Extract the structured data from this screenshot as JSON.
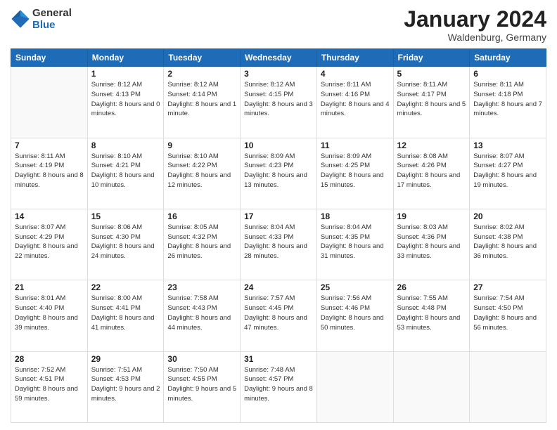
{
  "header": {
    "logo_line1": "General",
    "logo_line2": "Blue",
    "month_year": "January 2024",
    "location": "Waldenburg, Germany"
  },
  "weekdays": [
    "Sunday",
    "Monday",
    "Tuesday",
    "Wednesday",
    "Thursday",
    "Friday",
    "Saturday"
  ],
  "weeks": [
    [
      {
        "day": "",
        "sunrise": "",
        "sunset": "",
        "daylight": ""
      },
      {
        "day": "1",
        "sunrise": "Sunrise: 8:12 AM",
        "sunset": "Sunset: 4:13 PM",
        "daylight": "Daylight: 8 hours and 0 minutes."
      },
      {
        "day": "2",
        "sunrise": "Sunrise: 8:12 AM",
        "sunset": "Sunset: 4:14 PM",
        "daylight": "Daylight: 8 hours and 1 minute."
      },
      {
        "day": "3",
        "sunrise": "Sunrise: 8:12 AM",
        "sunset": "Sunset: 4:15 PM",
        "daylight": "Daylight: 8 hours and 3 minutes."
      },
      {
        "day": "4",
        "sunrise": "Sunrise: 8:11 AM",
        "sunset": "Sunset: 4:16 PM",
        "daylight": "Daylight: 8 hours and 4 minutes."
      },
      {
        "day": "5",
        "sunrise": "Sunrise: 8:11 AM",
        "sunset": "Sunset: 4:17 PM",
        "daylight": "Daylight: 8 hours and 5 minutes."
      },
      {
        "day": "6",
        "sunrise": "Sunrise: 8:11 AM",
        "sunset": "Sunset: 4:18 PM",
        "daylight": "Daylight: 8 hours and 7 minutes."
      }
    ],
    [
      {
        "day": "7",
        "sunrise": "Sunrise: 8:11 AM",
        "sunset": "Sunset: 4:19 PM",
        "daylight": "Daylight: 8 hours and 8 minutes."
      },
      {
        "day": "8",
        "sunrise": "Sunrise: 8:10 AM",
        "sunset": "Sunset: 4:21 PM",
        "daylight": "Daylight: 8 hours and 10 minutes."
      },
      {
        "day": "9",
        "sunrise": "Sunrise: 8:10 AM",
        "sunset": "Sunset: 4:22 PM",
        "daylight": "Daylight: 8 hours and 12 minutes."
      },
      {
        "day": "10",
        "sunrise": "Sunrise: 8:09 AM",
        "sunset": "Sunset: 4:23 PM",
        "daylight": "Daylight: 8 hours and 13 minutes."
      },
      {
        "day": "11",
        "sunrise": "Sunrise: 8:09 AM",
        "sunset": "Sunset: 4:25 PM",
        "daylight": "Daylight: 8 hours and 15 minutes."
      },
      {
        "day": "12",
        "sunrise": "Sunrise: 8:08 AM",
        "sunset": "Sunset: 4:26 PM",
        "daylight": "Daylight: 8 hours and 17 minutes."
      },
      {
        "day": "13",
        "sunrise": "Sunrise: 8:07 AM",
        "sunset": "Sunset: 4:27 PM",
        "daylight": "Daylight: 8 hours and 19 minutes."
      }
    ],
    [
      {
        "day": "14",
        "sunrise": "Sunrise: 8:07 AM",
        "sunset": "Sunset: 4:29 PM",
        "daylight": "Daylight: 8 hours and 22 minutes."
      },
      {
        "day": "15",
        "sunrise": "Sunrise: 8:06 AM",
        "sunset": "Sunset: 4:30 PM",
        "daylight": "Daylight: 8 hours and 24 minutes."
      },
      {
        "day": "16",
        "sunrise": "Sunrise: 8:05 AM",
        "sunset": "Sunset: 4:32 PM",
        "daylight": "Daylight: 8 hours and 26 minutes."
      },
      {
        "day": "17",
        "sunrise": "Sunrise: 8:04 AM",
        "sunset": "Sunset: 4:33 PM",
        "daylight": "Daylight: 8 hours and 28 minutes."
      },
      {
        "day": "18",
        "sunrise": "Sunrise: 8:04 AM",
        "sunset": "Sunset: 4:35 PM",
        "daylight": "Daylight: 8 hours and 31 minutes."
      },
      {
        "day": "19",
        "sunrise": "Sunrise: 8:03 AM",
        "sunset": "Sunset: 4:36 PM",
        "daylight": "Daylight: 8 hours and 33 minutes."
      },
      {
        "day": "20",
        "sunrise": "Sunrise: 8:02 AM",
        "sunset": "Sunset: 4:38 PM",
        "daylight": "Daylight: 8 hours and 36 minutes."
      }
    ],
    [
      {
        "day": "21",
        "sunrise": "Sunrise: 8:01 AM",
        "sunset": "Sunset: 4:40 PM",
        "daylight": "Daylight: 8 hours and 39 minutes."
      },
      {
        "day": "22",
        "sunrise": "Sunrise: 8:00 AM",
        "sunset": "Sunset: 4:41 PM",
        "daylight": "Daylight: 8 hours and 41 minutes."
      },
      {
        "day": "23",
        "sunrise": "Sunrise: 7:58 AM",
        "sunset": "Sunset: 4:43 PM",
        "daylight": "Daylight: 8 hours and 44 minutes."
      },
      {
        "day": "24",
        "sunrise": "Sunrise: 7:57 AM",
        "sunset": "Sunset: 4:45 PM",
        "daylight": "Daylight: 8 hours and 47 minutes."
      },
      {
        "day": "25",
        "sunrise": "Sunrise: 7:56 AM",
        "sunset": "Sunset: 4:46 PM",
        "daylight": "Daylight: 8 hours and 50 minutes."
      },
      {
        "day": "26",
        "sunrise": "Sunrise: 7:55 AM",
        "sunset": "Sunset: 4:48 PM",
        "daylight": "Daylight: 8 hours and 53 minutes."
      },
      {
        "day": "27",
        "sunrise": "Sunrise: 7:54 AM",
        "sunset": "Sunset: 4:50 PM",
        "daylight": "Daylight: 8 hours and 56 minutes."
      }
    ],
    [
      {
        "day": "28",
        "sunrise": "Sunrise: 7:52 AM",
        "sunset": "Sunset: 4:51 PM",
        "daylight": "Daylight: 8 hours and 59 minutes."
      },
      {
        "day": "29",
        "sunrise": "Sunrise: 7:51 AM",
        "sunset": "Sunset: 4:53 PM",
        "daylight": "Daylight: 9 hours and 2 minutes."
      },
      {
        "day": "30",
        "sunrise": "Sunrise: 7:50 AM",
        "sunset": "Sunset: 4:55 PM",
        "daylight": "Daylight: 9 hours and 5 minutes."
      },
      {
        "day": "31",
        "sunrise": "Sunrise: 7:48 AM",
        "sunset": "Sunset: 4:57 PM",
        "daylight": "Daylight: 9 hours and 8 minutes."
      },
      {
        "day": "",
        "sunrise": "",
        "sunset": "",
        "daylight": ""
      },
      {
        "day": "",
        "sunrise": "",
        "sunset": "",
        "daylight": ""
      },
      {
        "day": "",
        "sunrise": "",
        "sunset": "",
        "daylight": ""
      }
    ]
  ]
}
